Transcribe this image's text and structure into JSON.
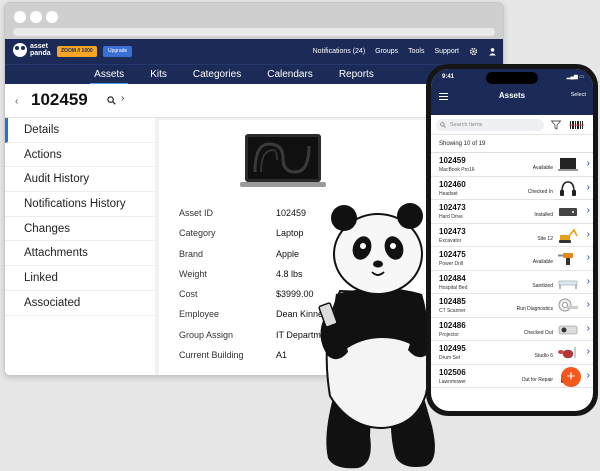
{
  "browser": {
    "logo_text": "asset panda",
    "promo_text": "ZOOM // 1000",
    "upgrade_label": "Upgrade",
    "top_nav": [
      "Notifications (24)",
      "Groups",
      "Tools",
      "Support"
    ],
    "main_tabs": [
      {
        "label": "Assets",
        "active": true
      },
      {
        "label": "Kits",
        "active": false
      },
      {
        "label": "Categories",
        "active": false
      },
      {
        "label": "Calendars",
        "active": false
      },
      {
        "label": "Reports",
        "active": false
      }
    ],
    "asset_id": "102459",
    "side_menu": [
      {
        "label": "Details",
        "active": true
      },
      {
        "label": "Actions",
        "active": false
      },
      {
        "label": "Audit History",
        "active": false
      },
      {
        "label": "Notifications History",
        "active": false
      },
      {
        "label": "Changes",
        "active": false
      },
      {
        "label": "Attachments",
        "active": false
      },
      {
        "label": "Linked",
        "active": false
      },
      {
        "label": "Associated",
        "active": false
      }
    ],
    "fields": [
      {
        "label": "Asset ID",
        "value": "102459"
      },
      {
        "label": "Category",
        "value": "Laptop"
      },
      {
        "label": "Brand",
        "value": "Apple"
      },
      {
        "label": "Weight",
        "value": "4.8 lbs"
      },
      {
        "label": "Cost",
        "value": "$3999.00"
      },
      {
        "label": "Employee",
        "value": "Dean Kinne"
      },
      {
        "label": "Group Assign",
        "value": "IT Departm"
      },
      {
        "label": "Current Building",
        "value": "A1"
      }
    ]
  },
  "phone": {
    "time": "9:41",
    "title": "Assets",
    "select_label": "Select",
    "search_placeholder": "Search Items",
    "showing_text": "Showing 10 of 19",
    "items": [
      {
        "id": "102459",
        "name": "MacBook Pro16",
        "status": "Available",
        "icon": "laptop"
      },
      {
        "id": "102460",
        "name": "Headset",
        "status": "Checked In",
        "icon": "headset"
      },
      {
        "id": "102473",
        "name": "Hard Drive",
        "status": "Installed",
        "icon": "hard-drive"
      },
      {
        "id": "102473",
        "name": "Excavator",
        "status": "Site 12",
        "icon": "excavator"
      },
      {
        "id": "102475",
        "name": "Power Drill",
        "status": "Available",
        "icon": "drill"
      },
      {
        "id": "102484",
        "name": "Hospital Bed",
        "status": "Sanitized",
        "icon": "bed"
      },
      {
        "id": "102485",
        "name": "CT Scanner",
        "status": "Run Diagnostics",
        "icon": "scanner"
      },
      {
        "id": "102486",
        "name": "Projector",
        "status": "Checked Out",
        "icon": "projector"
      },
      {
        "id": "102495",
        "name": "Drum Set",
        "status": "Studio 6",
        "icon": "drums"
      },
      {
        "id": "102506",
        "name": "Lawnmower",
        "status": "Out for Repair",
        "icon": "lawnmower"
      }
    ],
    "fab_label": "+"
  },
  "colors": {
    "navy": "#1b2a56",
    "accent": "#4ea3ff",
    "fab": "#f2571e",
    "promo": "#f6a623"
  }
}
